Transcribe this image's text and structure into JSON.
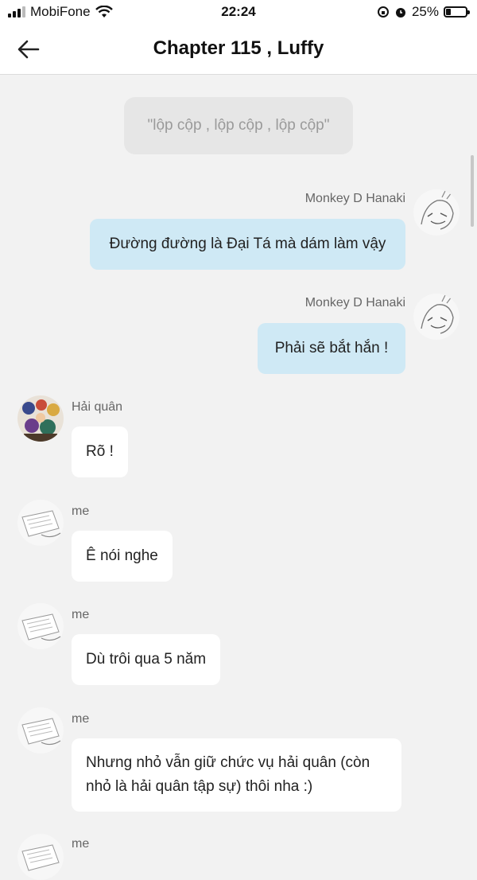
{
  "status": {
    "carrier": "MobiFone",
    "time": "22:24",
    "battery_text": "25%",
    "battery_level": 0.25
  },
  "header": {
    "title": "Chapter 115 , Luffy"
  },
  "narration": "\"lộp cộp , lộp cộp , lộp cộp\"",
  "messages": [
    {
      "sender": "Monkey D Hanaki",
      "text": "Đường đường là Đại Tá mà dám làm vậy",
      "side": "right"
    },
    {
      "sender": "Monkey D Hanaki",
      "text": "Phải sẽ bắt hắn !",
      "side": "right"
    },
    {
      "sender": "Hải quân",
      "text": "Rõ !",
      "side": "left"
    },
    {
      "sender": "me",
      "text": "Ê nói nghe",
      "side": "left"
    },
    {
      "sender": "me",
      "text": "Dù trôi qua 5 năm",
      "side": "left"
    },
    {
      "sender": "me",
      "text": "Nhưng nhỏ vẫn giữ chức vụ hải quân (còn nhỏ là hải quân tập sự) thôi nha :)",
      "side": "left"
    },
    {
      "sender": "me",
      "side": "left"
    }
  ],
  "colors": {
    "background": "#f2f2f2",
    "outgoing_bubble": "#cfe9f5",
    "incoming_bubble": "#ffffff",
    "narration_bubble": "#e6e6e6"
  }
}
